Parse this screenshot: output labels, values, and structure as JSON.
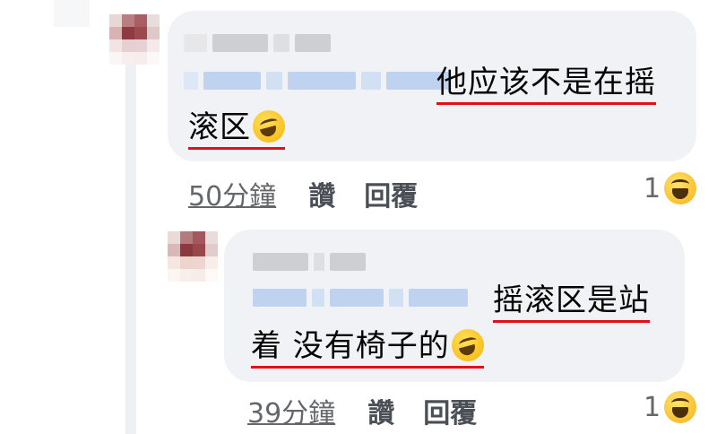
{
  "comments": [
    {
      "line1": "他应该不是在摇",
      "line2": "滚区",
      "time": "50分鐘",
      "like": "讚",
      "reply": "回覆",
      "reaction_count": "1",
      "emoji": "rolling-on-floor-laughing-icon",
      "reaction": "laughing-face-icon"
    },
    {
      "line1": "摇滚区是站",
      "line2": "着 没有椅子的",
      "time": "39分鐘",
      "like": "讚",
      "reply": "回覆",
      "reaction_count": "1",
      "emoji": "rolling-on-floor-laughing-icon",
      "reaction": "laughing-face-icon"
    }
  ],
  "colors": {
    "bubble": "#f0f2f5",
    "underline": "#e0101a",
    "meta_text": "#65676b"
  }
}
